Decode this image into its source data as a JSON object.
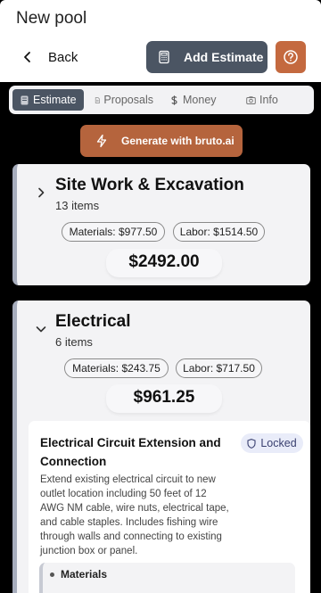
{
  "header": {
    "title": "New pool",
    "back_label": "Back",
    "add_estimate_label": "Add Estimate"
  },
  "tabs": [
    {
      "label": "Estimate",
      "icon": "document-icon",
      "active": true
    },
    {
      "label": "Proposals",
      "icon": "file-icon",
      "active": false
    },
    {
      "label": "Money",
      "icon": "dollar-icon",
      "active": false
    },
    {
      "label": "Info",
      "icon": "camera-icon",
      "active": false
    }
  ],
  "generate_label": "Generate with bruto.ai",
  "sections": [
    {
      "title": "Site Work & Excavation",
      "count": "13 items",
      "materials": "Materials: $977.50",
      "labor": "Labor: $1514.50",
      "total": "$2492.00",
      "expanded": false
    },
    {
      "title": "Electrical",
      "count": "6 items",
      "materials": "Materials: $243.75",
      "labor": "Labor: $717.50",
      "total": "$961.25",
      "expanded": true,
      "items": [
        {
          "title": "Electrical Circuit Extension and Connection",
          "badge": "Locked",
          "description": "Extend existing electrical circuit to new outlet location including 50 feet of 12 AWG NM cable, wire nuts, electrical tape, and cable staples. Includes fishing wire through walls and connecting to existing junction box or panel.",
          "materials_label": "Materials"
        }
      ]
    }
  ],
  "colors": {
    "primary_dark": "#4b5563",
    "accent_orange": "#c4693f",
    "locked_badge_bg": "#e9ecf9"
  }
}
